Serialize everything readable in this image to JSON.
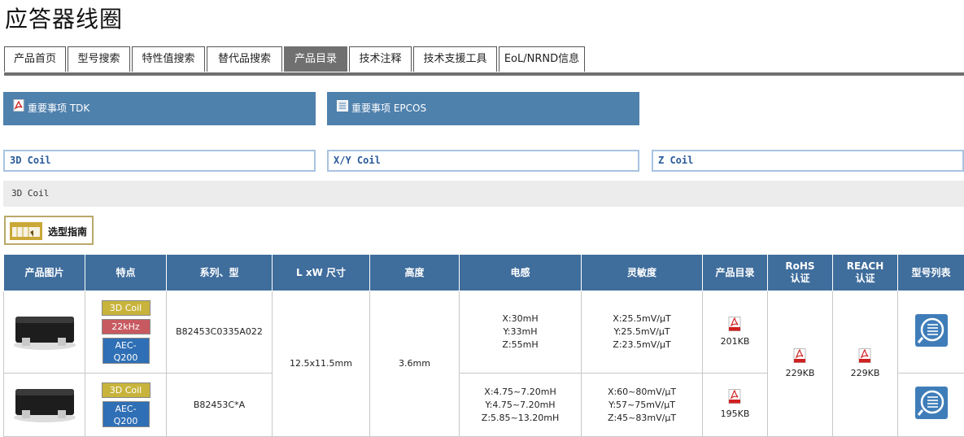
{
  "page": {
    "title": "应答器线圈"
  },
  "tabs": [
    {
      "label": "产品首页",
      "active": false
    },
    {
      "label": "型号搜索",
      "active": false
    },
    {
      "label": "特性值搜索",
      "active": false
    },
    {
      "label": "替代品搜索",
      "active": false
    },
    {
      "label": "产品目录",
      "active": true
    },
    {
      "label": "技术注释",
      "active": false
    },
    {
      "label": "技术支援工具",
      "active": false
    },
    {
      "label": "EoL/NRND信息",
      "active": false
    }
  ],
  "notices": [
    {
      "label": "重要事项 TDK",
      "icon": "pdf-icon"
    },
    {
      "label": "重要事项 EPCOS",
      "icon": "document-icon"
    }
  ],
  "coil_links": [
    "3D Coil",
    "X/Y Coil",
    "Z Coil"
  ],
  "section": {
    "title": "3D Coil"
  },
  "guide": {
    "label": "选型指南"
  },
  "table": {
    "headers": [
      "产品图片",
      "特点",
      "系列、型",
      "L xW 尺寸",
      "高度",
      "电感",
      "灵敏度",
      "产品目录",
      "RoHS\n认证",
      "REACH\n认证",
      "型号列表"
    ],
    "shared": {
      "size": "12.5x11.5mm",
      "height": "3.6mm",
      "rohs": "229KB",
      "reach": "229KB"
    },
    "rows": [
      {
        "features": [
          "3D Coil",
          "22kHz",
          "AEC-\nQ200"
        ],
        "series": "B82453C0335A022",
        "inductance": "X:30mH\nY:33mH\nZ:55mH",
        "sensitivity": "X:25.5mV/μT\nY:25.5mV/μT\nZ:23.5mV/μT",
        "catalog": "201KB"
      },
      {
        "features": [
          "3D Coil",
          "AEC-\nQ200"
        ],
        "series": "B82453C*A",
        "inductance": "X:4.75~7.20mH\nY:4.75~7.20mH\nZ:5.85~13.20mH",
        "sensitivity": "X:60~80mV/μT\nY:57~75mV/μT\nZ:45~83mV/μT",
        "catalog": "195KB"
      }
    ]
  },
  "colors": {
    "accent": "#4f81ad",
    "header": "#3f6d9c",
    "active_tab": "#707070"
  }
}
